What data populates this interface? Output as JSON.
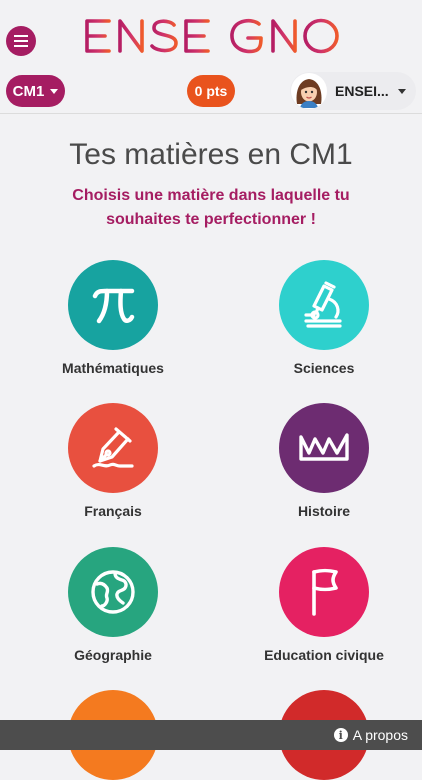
{
  "header": {
    "logo_text": "ENSEIGNO",
    "level": "CM1",
    "points": "0 pts",
    "user_name": "ENSEI..."
  },
  "main": {
    "title": "Tes matières en CM1",
    "subtitle": "Choisis une matière dans laquelle tu souhaites te perfectionner !"
  },
  "subjects": [
    {
      "label": "Mathématiques",
      "color": "#17a3a0",
      "icon": "pi-icon"
    },
    {
      "label": "Sciences",
      "color": "#2ed0cd",
      "icon": "microscope-icon"
    },
    {
      "label": "Français",
      "color": "#e8503f",
      "icon": "pen-icon"
    },
    {
      "label": "Histoire",
      "color": "#6d2c71",
      "icon": "crown-icon"
    },
    {
      "label": "Géographie",
      "color": "#27a57f",
      "icon": "globe-icon"
    },
    {
      "label": "Education civique",
      "color": "#e52162",
      "icon": "flag-icon"
    },
    {
      "label": "",
      "color": "#f47a1f",
      "icon": "unknown-icon"
    },
    {
      "label": "",
      "color": "#d12a2a",
      "icon": "unknown-icon"
    }
  ],
  "footer": {
    "about_label": "A propos"
  },
  "colors": {
    "brand": "#a51d62",
    "points": "#e9531d",
    "footer": "#4d4d4d"
  }
}
